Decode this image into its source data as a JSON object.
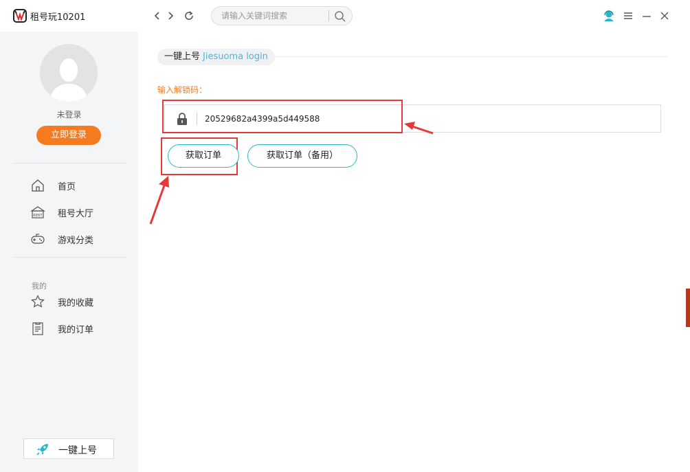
{
  "app": {
    "title": "租号玩10201",
    "logo_icon": "zuhaowan-logo-icon"
  },
  "titlebar": {
    "search_placeholder": "请输入关键词搜索",
    "icons": [
      "back-icon",
      "forward-icon",
      "refresh-icon",
      "search-icon",
      "customer-service-icon",
      "menu-icon",
      "minimize-icon",
      "close-icon"
    ]
  },
  "sidebar": {
    "login_state": "未登录",
    "login_button": "立即登录",
    "nav": [
      {
        "label": "首页",
        "icon": "home-icon"
      },
      {
        "label": "租号大厅",
        "icon": "rent-hall-icon"
      },
      {
        "label": "游戏分类",
        "icon": "gamepad-icon"
      }
    ],
    "section_title": "我的",
    "mine": [
      {
        "label": "我的收藏",
        "icon": "star-icon"
      },
      {
        "label": "我的订单",
        "icon": "order-list-icon"
      }
    ],
    "quick_login": "一键上号"
  },
  "main": {
    "section_title": "一键上号",
    "section_subtitle": "Jiesuoma login",
    "field_label": "输入解锁码：",
    "unlock_code": "20529682a4399a5d449588",
    "buttons": {
      "get_order": "获取订单",
      "get_order_backup": "获取订单（备用）"
    }
  },
  "colors": {
    "accent_orange": "#f47b20",
    "accent_teal": "#29b6c9",
    "highlight_red": "#e63838",
    "sidebar_bg": "#f4f5f7"
  }
}
